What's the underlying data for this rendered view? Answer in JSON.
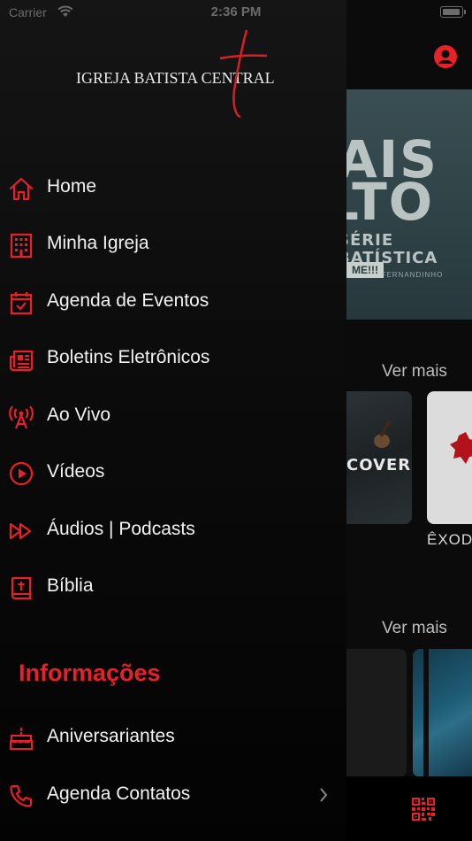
{
  "status_bar": {
    "carrier": "Carrier",
    "time": "2:36 PM"
  },
  "drawer": {
    "logo_text": "IGREJA BATISTA CENTRAL",
    "menu": [
      {
        "label": "Home",
        "icon": "home-icon"
      },
      {
        "label": "Minha Igreja",
        "icon": "building-icon"
      },
      {
        "label": "Agenda de Eventos",
        "icon": "calendar-check-icon"
      },
      {
        "label": "Boletins Eletrônicos",
        "icon": "newspaper-icon"
      },
      {
        "label": "Ao Vivo",
        "icon": "broadcast-tower-icon"
      },
      {
        "label": "Vídeos",
        "icon": "play-circle-icon"
      },
      {
        "label": "Áudios | Podcasts",
        "icon": "fast-forward-icon"
      },
      {
        "label": "Bíblia",
        "icon": "bible-icon"
      }
    ],
    "info_title": "Informações",
    "info_menu": [
      {
        "label": "Aniversariantes",
        "icon": "birthday-cake-icon"
      },
      {
        "label": "Agenda Contatos",
        "icon": "phone-icon"
      }
    ]
  },
  "background": {
    "banner": {
      "line1": "MAIS",
      "line2": "ALTO",
      "line3": "SÉRIE",
      "line4": "BATÍSTICA",
      "tiny": "PR. FERNANDINHO",
      "tag": "ME!!!"
    },
    "see_more_1": "Ver mais",
    "see_more_2": "Ver mais",
    "card1_text": "COVER",
    "card2_label": "ÊXODO"
  },
  "colors": {
    "accent": "#e8202a",
    "drawer_bg": "#0c0c0c",
    "text": "#f2f2f2"
  }
}
